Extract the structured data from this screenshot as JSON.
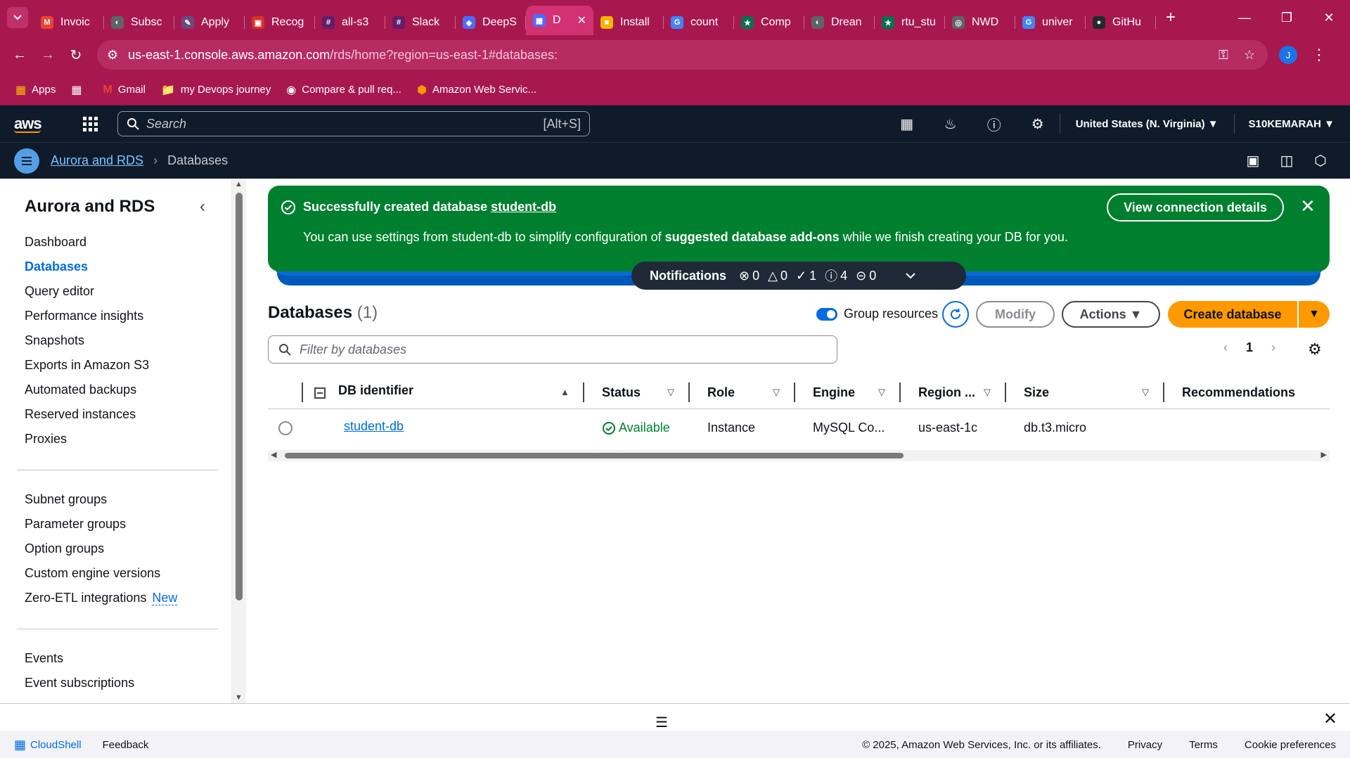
{
  "browser": {
    "tabs": [
      {
        "label": "Invoic",
        "fav": "M",
        "color": "#ea4335"
      },
      {
        "label": "Subsc",
        "fav": "◐",
        "color": "#5f6368"
      },
      {
        "label": "Apply",
        "fav": "✎",
        "color": "#6b4a7a"
      },
      {
        "label": "Recog",
        "fav": "▣",
        "color": "#d93025"
      },
      {
        "label": "all-s3",
        "fav": "#",
        "color": "#611f69"
      },
      {
        "label": "Slack",
        "fav": "#",
        "color": "#611f69"
      },
      {
        "label": "DeepS",
        "fav": "◆",
        "color": "#4d6bfe"
      },
      {
        "label": "D",
        "fav": "▦",
        "color": "#4d6bfe",
        "active": true
      },
      {
        "label": "Install",
        "fav": "■",
        "color": "#f4b400"
      },
      {
        "label": "count",
        "fav": "G",
        "color": "#4285f4"
      },
      {
        "label": "Comp",
        "fav": "★",
        "color": "#0b6e4f"
      },
      {
        "label": "Drean",
        "fav": "◐",
        "color": "#5f6368"
      },
      {
        "label": "rtu_stu",
        "fav": "★",
        "color": "#0b6e4f"
      },
      {
        "label": "NWD",
        "fav": "◎",
        "color": "#5f6368"
      },
      {
        "label": "univer",
        "fav": "G",
        "color": "#4285f4"
      },
      {
        "label": "GitHu",
        "fav": "●",
        "color": "#24292f"
      }
    ],
    "new_tab": "+",
    "url_host": "us-east-1.console.aws.amazon.com",
    "url_rest": "/rds/home?region=us-east-1#databases:",
    "profile_initial": "J",
    "bookmarks": [
      {
        "label": "Apps",
        "icon": "apps-icon"
      },
      {
        "label": "",
        "icon": "tab-groups-icon"
      },
      {
        "label": "Gmail",
        "icon": "gmail-icon"
      },
      {
        "label": "my Devops journey",
        "icon": "folder-icon"
      },
      {
        "label": "Compare & pull req...",
        "icon": "github-icon"
      },
      {
        "label": "Amazon Web Servic...",
        "icon": "aws-icon"
      }
    ]
  },
  "aws": {
    "logo": "aws",
    "search_placeholder": "Search",
    "search_shortcut": "[Alt+S]",
    "region": "United States (N. Virginia) ▼",
    "account": "S10KEMARAH ▼",
    "breadcrumb": [
      "Aurora and RDS",
      "Databases"
    ]
  },
  "sidebar": {
    "title": "Aurora and RDS",
    "group1": [
      "Dashboard",
      "Databases",
      "Query editor",
      "Performance insights",
      "Snapshots",
      "Exports in Amazon S3",
      "Automated backups",
      "Reserved instances",
      "Proxies"
    ],
    "group2": [
      "Subnet groups",
      "Parameter groups",
      "Option groups",
      "Custom engine versions",
      "Zero-ETL integrations"
    ],
    "new_badge": "New",
    "group3": [
      "Events",
      "Event subscriptions"
    ]
  },
  "flash": {
    "title_prefix": "Successfully created database ",
    "title_link": "student-db",
    "msg_1": "You can use settings from student-db to simplify configuration of ",
    "msg_bold": "suggested database add-ons",
    "msg_2": " while we finish creating your DB for you.",
    "button": "View connection details",
    "color": "#00802f"
  },
  "notifications": {
    "label": "Notifications",
    "error": "0",
    "warning": "0",
    "success": "1",
    "info": "4",
    "in_progress": "0"
  },
  "databases": {
    "title": "Databases",
    "count": "(1)",
    "group_resources": "Group resources",
    "modify": "Modify",
    "actions": "Actions ▼",
    "create": "Create database",
    "filter_placeholder": "Filter by databases",
    "page": "1",
    "columns": [
      "DB identifier",
      "Status",
      "Role",
      "Engine",
      "Region ...",
      "Size",
      "Recommendations"
    ],
    "rows": [
      {
        "id": "student-db",
        "status": "Available",
        "role": "Instance",
        "engine": "MySQL Co...",
        "region": "us-east-1c",
        "size": "db.t3.micro",
        "recommendations": ""
      }
    ]
  },
  "footer": {
    "cloudshell": "CloudShell",
    "feedback": "Feedback",
    "copyright": "© 2025, Amazon Web Services, Inc. or its affiliates.",
    "privacy": "Privacy",
    "terms": "Terms",
    "cookies": "Cookie preferences"
  }
}
